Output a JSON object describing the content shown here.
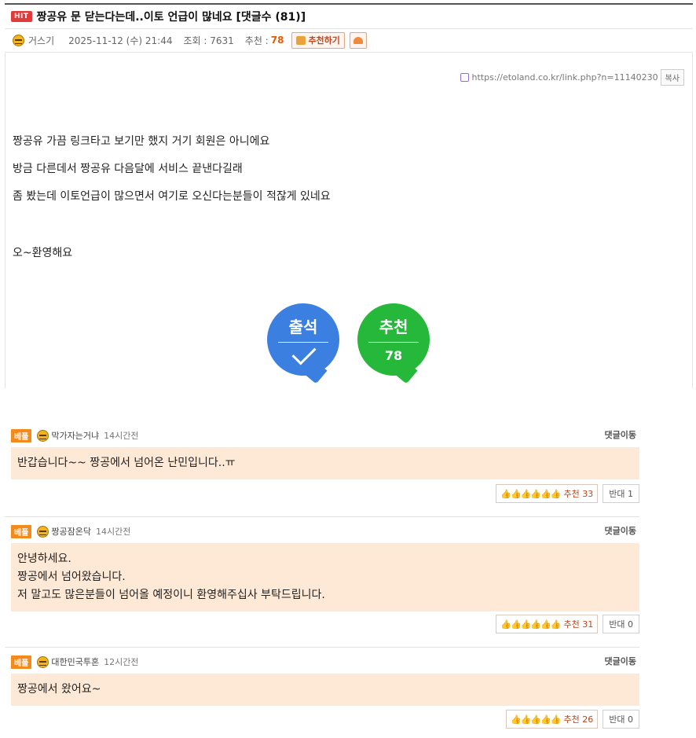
{
  "post": {
    "badge": "HIT",
    "title": "짱공유 문 닫는다는데..이토 언급이 많네요 [댓글수 (81)]",
    "author": "거스기",
    "date": "2025-11-12 (수) 21:44",
    "views_label": "조회 : 7631",
    "rec_label": "추천 :",
    "rec_count": "78",
    "rec_button": "추천하기",
    "link_url": "https://etoland.co.kr/link.php?n=11140230",
    "copy_label": "복사",
    "body_lines": [
      "짱공유 가끔 링크타고 보기만 했지 거기 회원은 아니에요",
      "방금 다른데서 짱공유 다음달에 서비스 끝낸다길래",
      "좀 봤는데 이토언급이 많으면서 여기로 오신다는분들이 적잖게 있네요",
      "오~환영해요"
    ],
    "attend_label": "출석",
    "recommend_label": "추천",
    "recommend_value": "78"
  },
  "comments": [
    {
      "badge": "베플",
      "author": "막가자는거냐",
      "time": "14시간전",
      "move": "댓글이동",
      "lines": [
        "반갑습니다~~ 짱공에서 넘어온 난민입니다..ㅠ"
      ],
      "thumbs": "👍👍👍👍👍👍",
      "up_label": "추천",
      "up_count": "33",
      "down_label": "반대",
      "down_count": "1"
    },
    {
      "badge": "베플",
      "author": "짱공잠온닥",
      "time": "14시간전",
      "move": "댓글이동",
      "lines": [
        "안녕하세요.",
        "짱공에서 넘어왔습니다.",
        "저 말고도 많은분들이 넘어올 예정이니 환영해주십사 부탁드립니다."
      ],
      "thumbs": "👍👍👍👍👍👍",
      "up_label": "추천",
      "up_count": "31",
      "down_label": "반대",
      "down_count": "0"
    },
    {
      "badge": "베플",
      "author": "대한민국투혼",
      "time": "12시간전",
      "move": "댓글이동",
      "lines": [
        "짱공에서 왔어요~"
      ],
      "thumbs": "👍👍👍👍👍",
      "up_label": "추천",
      "up_count": "26",
      "down_label": "반대",
      "down_count": "0"
    }
  ],
  "colors": {
    "hit": "#e03b3b",
    "best": "#f28a1e",
    "comment_bg": "#fde9d5",
    "attend_blue": "#3b7fe0",
    "recommend_green": "#25b83a"
  }
}
